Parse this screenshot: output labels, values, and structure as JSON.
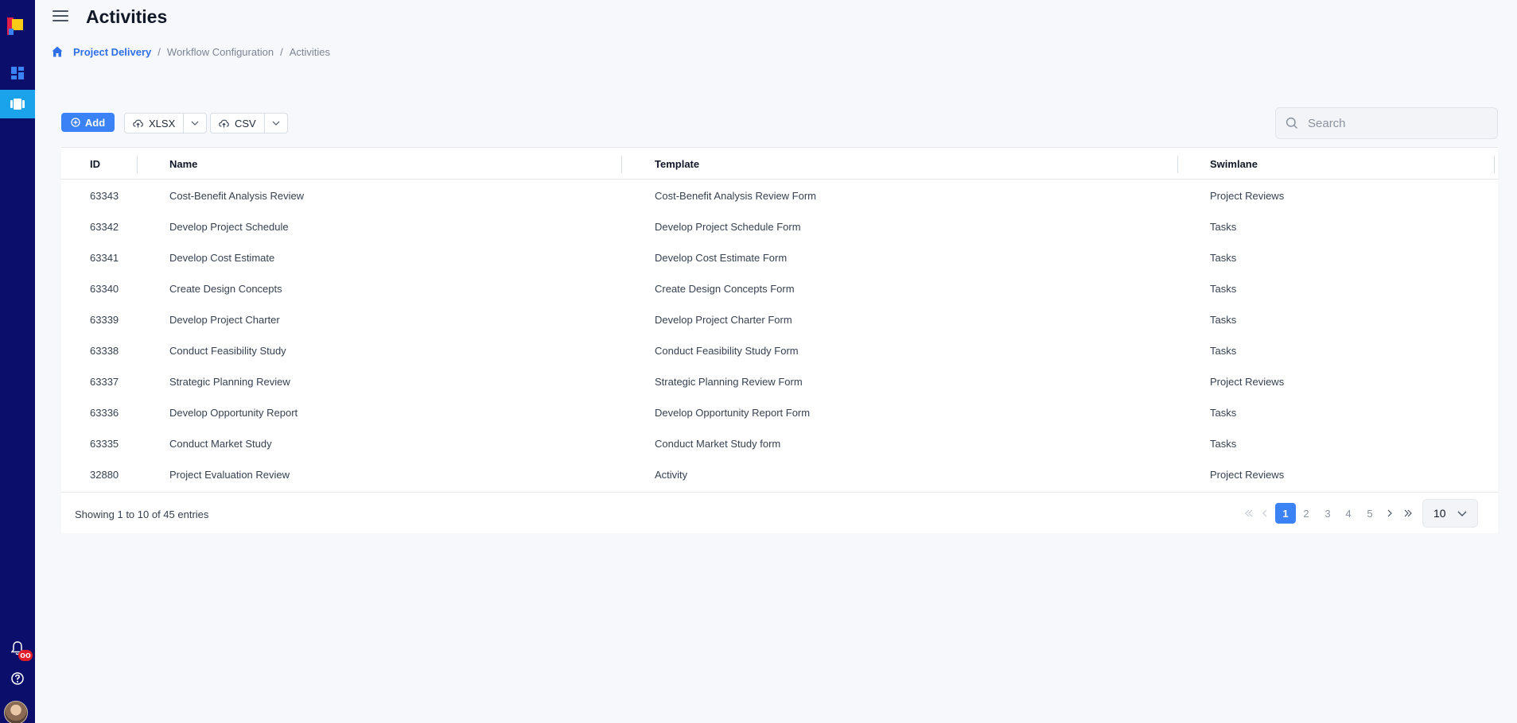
{
  "header": {
    "title": "Activities"
  },
  "breadcrumb": {
    "items": [
      "Project Delivery",
      "Workflow Configuration",
      "Activities"
    ]
  },
  "sidebar": {
    "notifications_badge": "oo"
  },
  "toolbar": {
    "add_label": "Add",
    "xlsx_label": "XLSX",
    "csv_label": "CSV",
    "search_placeholder": "Search"
  },
  "table": {
    "columns": [
      "ID",
      "Name",
      "Template",
      "Swimlane"
    ],
    "rows": [
      [
        "63343",
        "Cost-Benefit Analysis Review",
        "Cost-Benefit Analysis Review Form",
        "Project Reviews"
      ],
      [
        "63342",
        "Develop Project Schedule",
        "Develop Project Schedule Form",
        "Tasks"
      ],
      [
        "63341",
        "Develop Cost Estimate",
        "Develop Cost Estimate Form",
        "Tasks"
      ],
      [
        "63340",
        "Create Design Concepts",
        "Create Design Concepts Form",
        "Tasks"
      ],
      [
        "63339",
        "Develop Project Charter",
        "Develop Project Charter Form",
        "Tasks"
      ],
      [
        "63338",
        "Conduct Feasibility Study",
        "Conduct Feasibility Study Form",
        "Tasks"
      ],
      [
        "63337",
        "Strategic Planning Review",
        "Strategic Planning Review Form",
        "Project Reviews"
      ],
      [
        "63336",
        "Develop Opportunity Report",
        "Develop Opportunity Report Form",
        "Tasks"
      ],
      [
        "63335",
        "Conduct Market Study",
        "Conduct Market Study form",
        "Tasks"
      ],
      [
        "32880",
        "Project Evaluation Review",
        "Activity",
        "Project Reviews"
      ]
    ]
  },
  "footer": {
    "showing": "Showing 1 to 10 of 45 entries",
    "pages": [
      "1",
      "2",
      "3",
      "4",
      "5"
    ],
    "current_page": "1",
    "per_page": "10"
  },
  "colors": {
    "sidebar": "#0b0f6b",
    "accent": "#3b82f6",
    "active_nav": "#1aa3ea",
    "badge": "#e11d2a"
  }
}
